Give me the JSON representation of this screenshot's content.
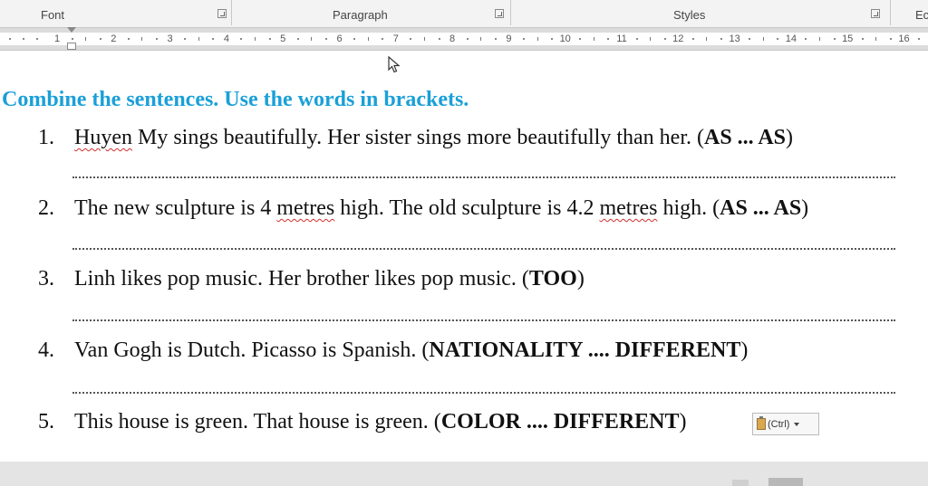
{
  "ribbon": {
    "groups": [
      "Font",
      "Paragraph",
      "Styles",
      "Ec"
    ]
  },
  "ruler": {
    "numbers": [
      "1",
      "2",
      "3",
      "4",
      "5",
      "6",
      "7",
      "8",
      "9",
      "10",
      "11",
      "12",
      "13",
      "14",
      "15",
      "16"
    ]
  },
  "document": {
    "heading": "Combine the sentences. Use the words in brackets.",
    "items": [
      {
        "num": "1.",
        "pre": "",
        "squiggle": "Huyen",
        "text": " My sings beautifully. Her sister sings more beautifully than her. (",
        "keyword": "AS ... AS",
        "post": ")"
      },
      {
        "num": "2.",
        "pre": "The new sculpture is 4 ",
        "squiggle": "metres",
        "text": " high. The old sculpture is 4.2 ",
        "squiggle2": "metres",
        "text2": " high. (",
        "keyword": "AS ... AS",
        "post": ")"
      },
      {
        "num": "3.",
        "pre": "Linh likes pop music. Her brother likes pop music. (",
        "keyword": "TOO",
        "post": ")"
      },
      {
        "num": "4.",
        "pre": "Van Gogh is Dutch. Picasso is Spanish. (",
        "keyword": "NATIONALITY .... DIFFERENT",
        "post": ")"
      },
      {
        "num": "5.",
        "pre": "This house is green. That house is green. (",
        "keyword": "COLOR .... DIFFERENT",
        "post": ")"
      }
    ],
    "paste_options_label": "(Ctrl)"
  }
}
